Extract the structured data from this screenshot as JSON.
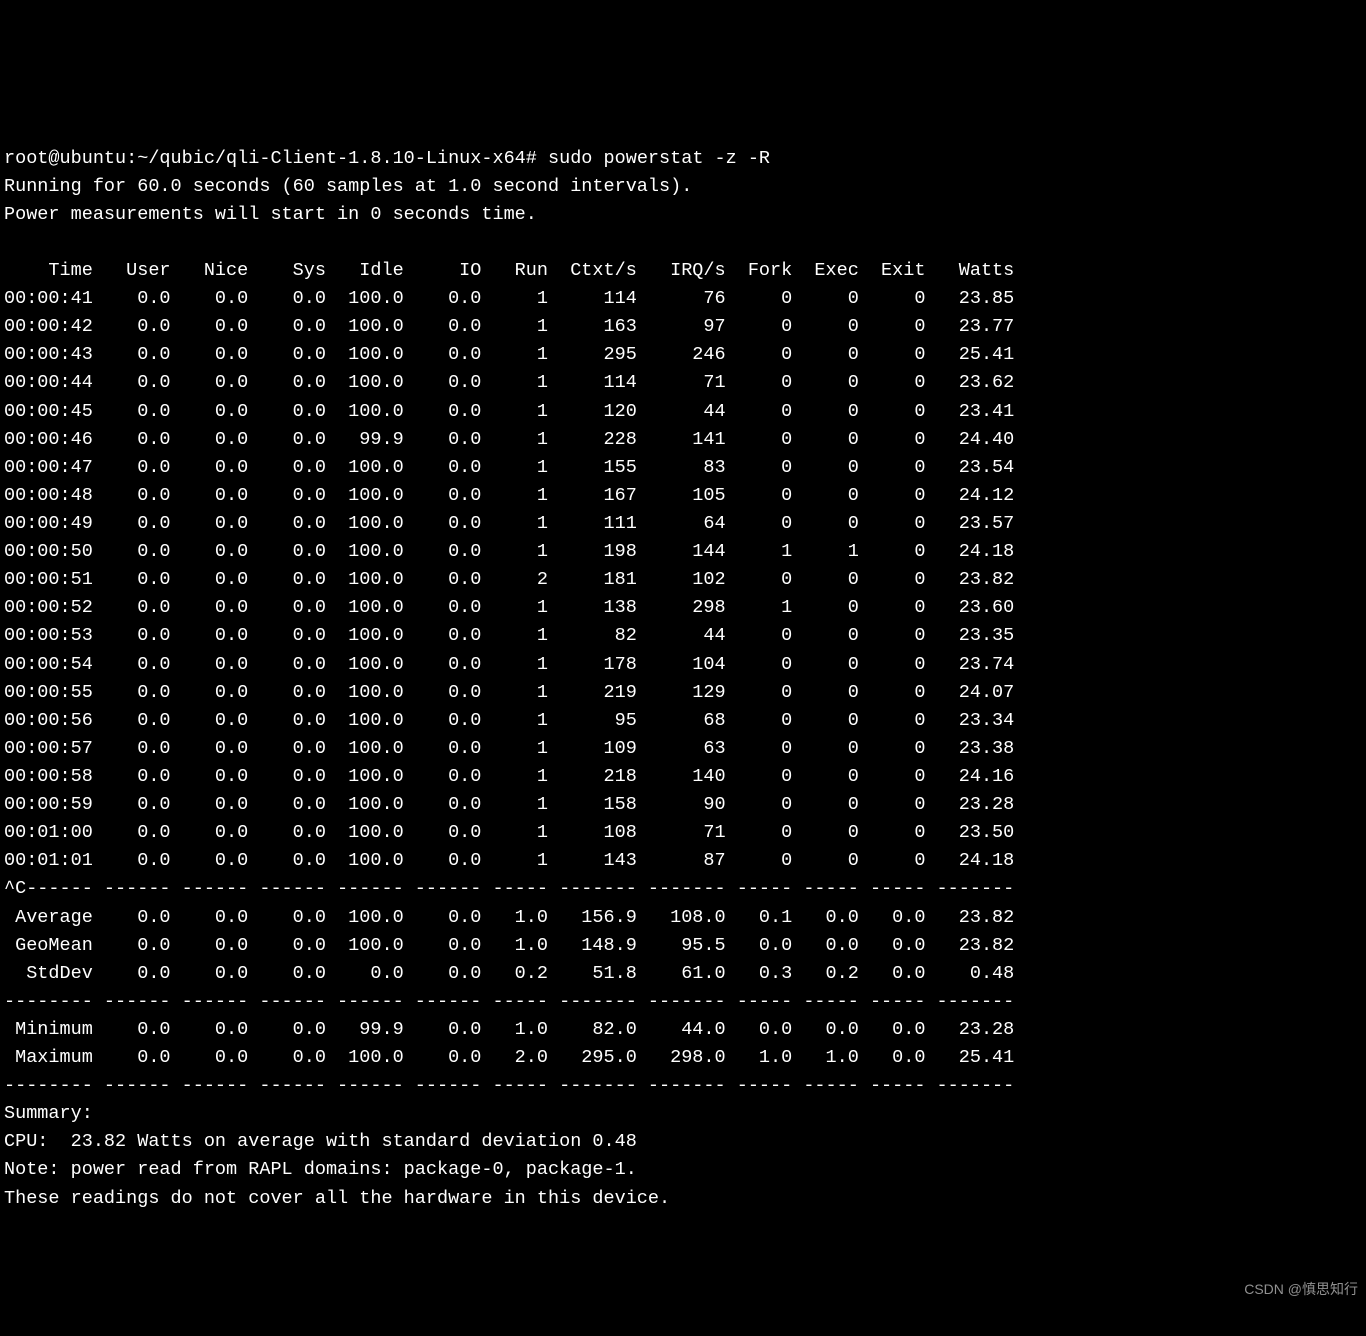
{
  "prompt_prefix": "root@ubuntu:~/qubic/qli-Client-1.8.10-Linux-x64# ",
  "command": "sudo powerstat -z -R",
  "intro_line1": "Running for 60.0 seconds (60 samples at 1.0 second intervals).",
  "intro_line2": "Power measurements will start in 0 seconds time.",
  "blank": "",
  "headers": [
    "Time",
    "User",
    "Nice",
    "Sys",
    "Idle",
    "IO",
    "Run",
    "Ctxt/s",
    "IRQ/s",
    "Fork",
    "Exec",
    "Exit",
    "Watts"
  ],
  "rows": [
    {
      "Time": "00:00:41",
      "User": "0.0",
      "Nice": "0.0",
      "Sys": "0.0",
      "Idle": "100.0",
      "IO": "0.0",
      "Run": "1",
      "Ctxt": "114",
      "IRQ": "76",
      "Fork": "0",
      "Exec": "0",
      "Exit": "0",
      "Watts": "23.85"
    },
    {
      "Time": "00:00:42",
      "User": "0.0",
      "Nice": "0.0",
      "Sys": "0.0",
      "Idle": "100.0",
      "IO": "0.0",
      "Run": "1",
      "Ctxt": "163",
      "IRQ": "97",
      "Fork": "0",
      "Exec": "0",
      "Exit": "0",
      "Watts": "23.77"
    },
    {
      "Time": "00:00:43",
      "User": "0.0",
      "Nice": "0.0",
      "Sys": "0.0",
      "Idle": "100.0",
      "IO": "0.0",
      "Run": "1",
      "Ctxt": "295",
      "IRQ": "246",
      "Fork": "0",
      "Exec": "0",
      "Exit": "0",
      "Watts": "25.41"
    },
    {
      "Time": "00:00:44",
      "User": "0.0",
      "Nice": "0.0",
      "Sys": "0.0",
      "Idle": "100.0",
      "IO": "0.0",
      "Run": "1",
      "Ctxt": "114",
      "IRQ": "71",
      "Fork": "0",
      "Exec": "0",
      "Exit": "0",
      "Watts": "23.62"
    },
    {
      "Time": "00:00:45",
      "User": "0.0",
      "Nice": "0.0",
      "Sys": "0.0",
      "Idle": "100.0",
      "IO": "0.0",
      "Run": "1",
      "Ctxt": "120",
      "IRQ": "44",
      "Fork": "0",
      "Exec": "0",
      "Exit": "0",
      "Watts": "23.41"
    },
    {
      "Time": "00:00:46",
      "User": "0.0",
      "Nice": "0.0",
      "Sys": "0.0",
      "Idle": "99.9",
      "IO": "0.0",
      "Run": "1",
      "Ctxt": "228",
      "IRQ": "141",
      "Fork": "0",
      "Exec": "0",
      "Exit": "0",
      "Watts": "24.40"
    },
    {
      "Time": "00:00:47",
      "User": "0.0",
      "Nice": "0.0",
      "Sys": "0.0",
      "Idle": "100.0",
      "IO": "0.0",
      "Run": "1",
      "Ctxt": "155",
      "IRQ": "83",
      "Fork": "0",
      "Exec": "0",
      "Exit": "0",
      "Watts": "23.54"
    },
    {
      "Time": "00:00:48",
      "User": "0.0",
      "Nice": "0.0",
      "Sys": "0.0",
      "Idle": "100.0",
      "IO": "0.0",
      "Run": "1",
      "Ctxt": "167",
      "IRQ": "105",
      "Fork": "0",
      "Exec": "0",
      "Exit": "0",
      "Watts": "24.12"
    },
    {
      "Time": "00:00:49",
      "User": "0.0",
      "Nice": "0.0",
      "Sys": "0.0",
      "Idle": "100.0",
      "IO": "0.0",
      "Run": "1",
      "Ctxt": "111",
      "IRQ": "64",
      "Fork": "0",
      "Exec": "0",
      "Exit": "0",
      "Watts": "23.57"
    },
    {
      "Time": "00:00:50",
      "User": "0.0",
      "Nice": "0.0",
      "Sys": "0.0",
      "Idle": "100.0",
      "IO": "0.0",
      "Run": "1",
      "Ctxt": "198",
      "IRQ": "144",
      "Fork": "1",
      "Exec": "1",
      "Exit": "0",
      "Watts": "24.18"
    },
    {
      "Time": "00:00:51",
      "User": "0.0",
      "Nice": "0.0",
      "Sys": "0.0",
      "Idle": "100.0",
      "IO": "0.0",
      "Run": "2",
      "Ctxt": "181",
      "IRQ": "102",
      "Fork": "0",
      "Exec": "0",
      "Exit": "0",
      "Watts": "23.82"
    },
    {
      "Time": "00:00:52",
      "User": "0.0",
      "Nice": "0.0",
      "Sys": "0.0",
      "Idle": "100.0",
      "IO": "0.0",
      "Run": "1",
      "Ctxt": "138",
      "IRQ": "298",
      "Fork": "1",
      "Exec": "0",
      "Exit": "0",
      "Watts": "23.60"
    },
    {
      "Time": "00:00:53",
      "User": "0.0",
      "Nice": "0.0",
      "Sys": "0.0",
      "Idle": "100.0",
      "IO": "0.0",
      "Run": "1",
      "Ctxt": "82",
      "IRQ": "44",
      "Fork": "0",
      "Exec": "0",
      "Exit": "0",
      "Watts": "23.35"
    },
    {
      "Time": "00:00:54",
      "User": "0.0",
      "Nice": "0.0",
      "Sys": "0.0",
      "Idle": "100.0",
      "IO": "0.0",
      "Run": "1",
      "Ctxt": "178",
      "IRQ": "104",
      "Fork": "0",
      "Exec": "0",
      "Exit": "0",
      "Watts": "23.74"
    },
    {
      "Time": "00:00:55",
      "User": "0.0",
      "Nice": "0.0",
      "Sys": "0.0",
      "Idle": "100.0",
      "IO": "0.0",
      "Run": "1",
      "Ctxt": "219",
      "IRQ": "129",
      "Fork": "0",
      "Exec": "0",
      "Exit": "0",
      "Watts": "24.07"
    },
    {
      "Time": "00:00:56",
      "User": "0.0",
      "Nice": "0.0",
      "Sys": "0.0",
      "Idle": "100.0",
      "IO": "0.0",
      "Run": "1",
      "Ctxt": "95",
      "IRQ": "68",
      "Fork": "0",
      "Exec": "0",
      "Exit": "0",
      "Watts": "23.34"
    },
    {
      "Time": "00:00:57",
      "User": "0.0",
      "Nice": "0.0",
      "Sys": "0.0",
      "Idle": "100.0",
      "IO": "0.0",
      "Run": "1",
      "Ctxt": "109",
      "IRQ": "63",
      "Fork": "0",
      "Exec": "0",
      "Exit": "0",
      "Watts": "23.38"
    },
    {
      "Time": "00:00:58",
      "User": "0.0",
      "Nice": "0.0",
      "Sys": "0.0",
      "Idle": "100.0",
      "IO": "0.0",
      "Run": "1",
      "Ctxt": "218",
      "IRQ": "140",
      "Fork": "0",
      "Exec": "0",
      "Exit": "0",
      "Watts": "24.16"
    },
    {
      "Time": "00:00:59",
      "User": "0.0",
      "Nice": "0.0",
      "Sys": "0.0",
      "Idle": "100.0",
      "IO": "0.0",
      "Run": "1",
      "Ctxt": "158",
      "IRQ": "90",
      "Fork": "0",
      "Exec": "0",
      "Exit": "0",
      "Watts": "23.28"
    },
    {
      "Time": "00:01:00",
      "User": "0.0",
      "Nice": "0.0",
      "Sys": "0.0",
      "Idle": "100.0",
      "IO": "0.0",
      "Run": "1",
      "Ctxt": "108",
      "IRQ": "71",
      "Fork": "0",
      "Exec": "0",
      "Exit": "0",
      "Watts": "23.50"
    },
    {
      "Time": "00:01:01",
      "User": "0.0",
      "Nice": "0.0",
      "Sys": "0.0",
      "Idle": "100.0",
      "IO": "0.0",
      "Run": "1",
      "Ctxt": "143",
      "IRQ": "87",
      "Fork": "0",
      "Exec": "0",
      "Exit": "0",
      "Watts": "24.18"
    }
  ],
  "break_prefix": "^C",
  "stats": [
    {
      "Time": "Average",
      "User": "0.0",
      "Nice": "0.0",
      "Sys": "0.0",
      "Idle": "100.0",
      "IO": "0.0",
      "Run": "1.0",
      "Ctxt": "156.9",
      "IRQ": "108.0",
      "Fork": "0.1",
      "Exec": "0.0",
      "Exit": "0.0",
      "Watts": "23.82"
    },
    {
      "Time": "GeoMean",
      "User": "0.0",
      "Nice": "0.0",
      "Sys": "0.0",
      "Idle": "100.0",
      "IO": "0.0",
      "Run": "1.0",
      "Ctxt": "148.9",
      "IRQ": "95.5",
      "Fork": "0.0",
      "Exec": "0.0",
      "Exit": "0.0",
      "Watts": "23.82"
    },
    {
      "Time": "StdDev",
      "User": "0.0",
      "Nice": "0.0",
      "Sys": "0.0",
      "Idle": "0.0",
      "IO": "0.0",
      "Run": "0.2",
      "Ctxt": "51.8",
      "IRQ": "61.0",
      "Fork": "0.3",
      "Exec": "0.2",
      "Exit": "0.0",
      "Watts": "0.48"
    }
  ],
  "minmax": [
    {
      "Time": "Minimum",
      "User": "0.0",
      "Nice": "0.0",
      "Sys": "0.0",
      "Idle": "99.9",
      "IO": "0.0",
      "Run": "1.0",
      "Ctxt": "82.0",
      "IRQ": "44.0",
      "Fork": "0.0",
      "Exec": "0.0",
      "Exit": "0.0",
      "Watts": "23.28"
    },
    {
      "Time": "Maximum",
      "User": "0.0",
      "Nice": "0.0",
      "Sys": "0.0",
      "Idle": "100.0",
      "IO": "0.0",
      "Run": "2.0",
      "Ctxt": "295.0",
      "IRQ": "298.0",
      "Fork": "1.0",
      "Exec": "1.0",
      "Exit": "0.0",
      "Watts": "25.41"
    }
  ],
  "summary_heading": "Summary:",
  "summary_cpu": "CPU:  23.82 Watts on average with standard deviation 0.48",
  "summary_note": "Note: power read from RAPL domains: package-0, package-1.",
  "summary_note2": "These readings do not cover all the hardware in this device.",
  "watermark": "CSDN @慎思知行",
  "col_widths": {
    "Time": 8,
    "User": 6,
    "Nice": 6,
    "Sys": 6,
    "Idle": 6,
    "IO": 6,
    "Run": 5,
    "Ctxt": 7,
    "IRQ": 7,
    "Fork": 5,
    "Exec": 5,
    "Exit": 5,
    "Watts": 7
  }
}
